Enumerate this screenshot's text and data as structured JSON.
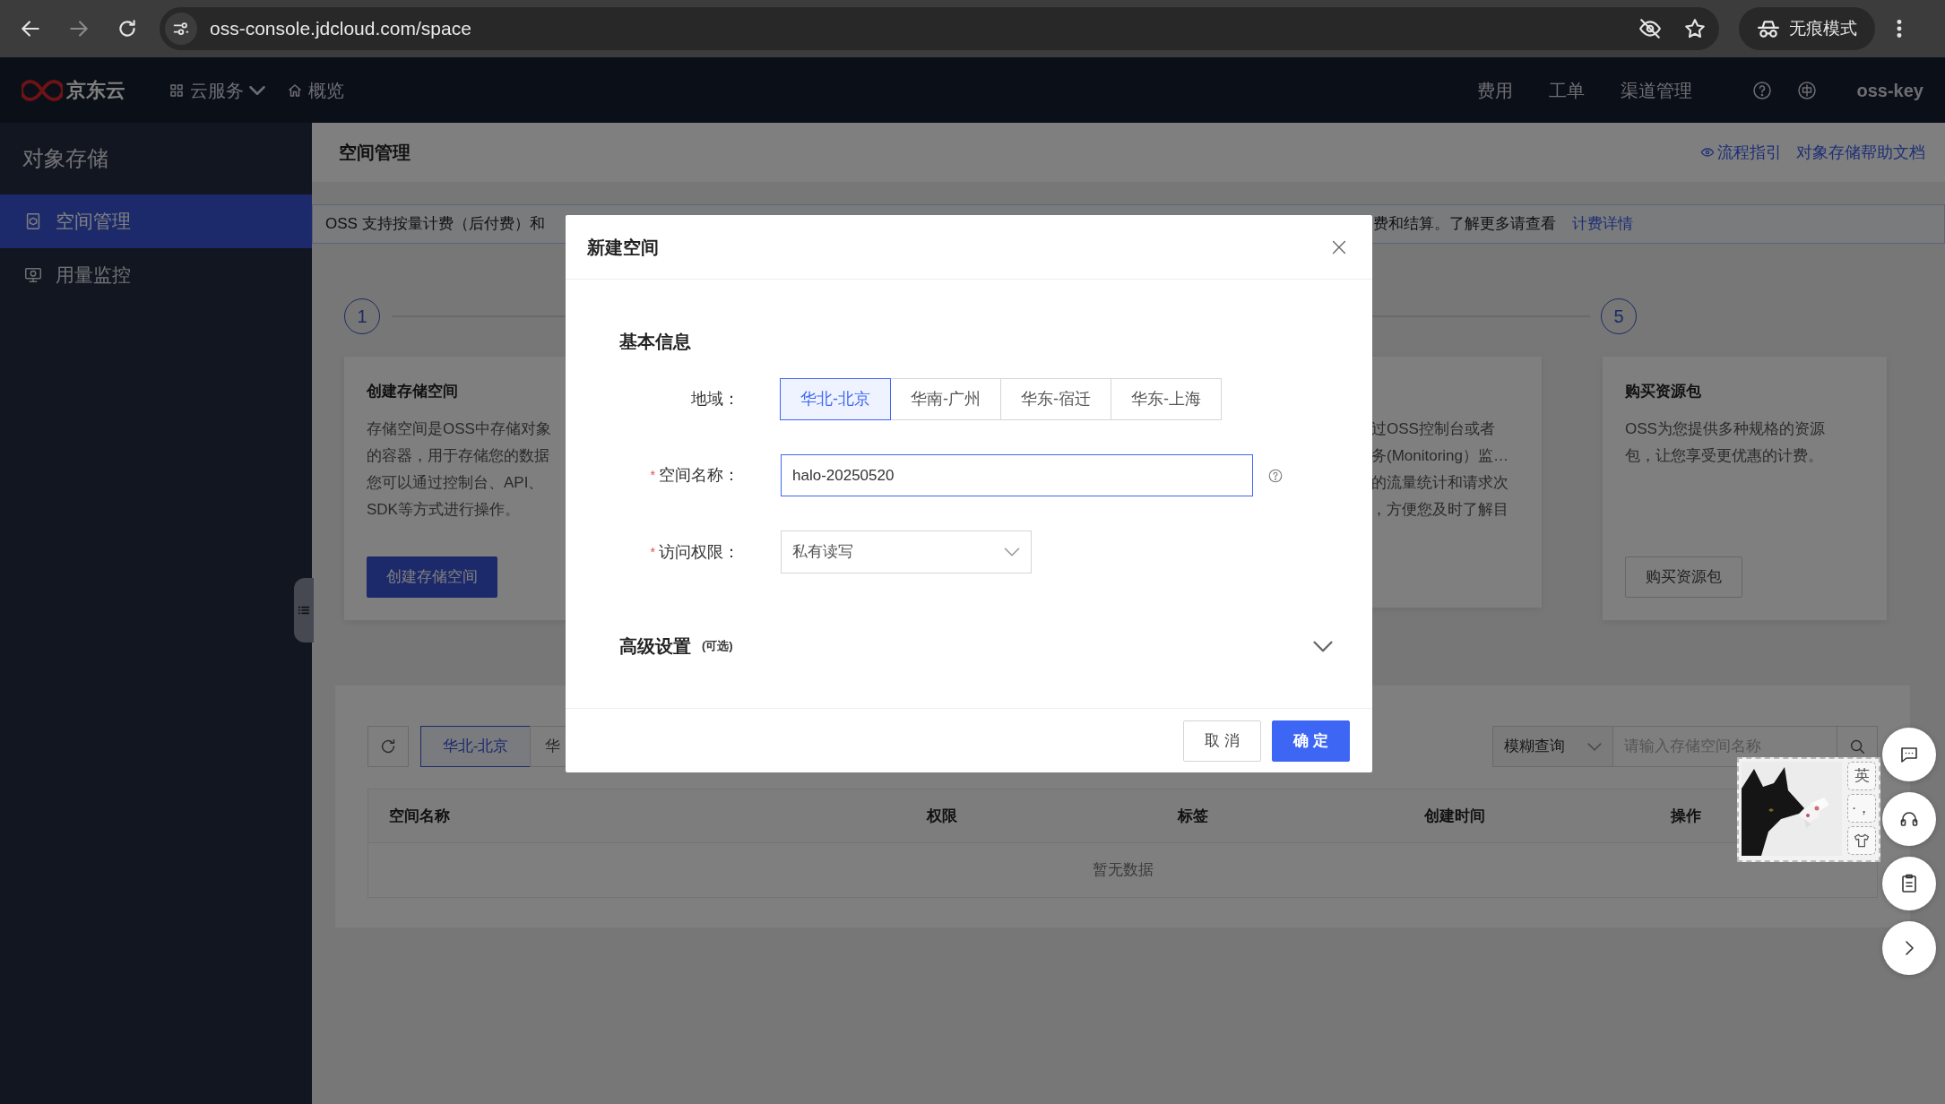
{
  "browser": {
    "url": "oss-console.jdcloud.com/space",
    "incognito_label": "无痕模式"
  },
  "topnav": {
    "logo_text": "京东云",
    "menu": [
      {
        "label": "云服务",
        "kind": "dropdown"
      },
      {
        "label": "概览",
        "kind": "home"
      }
    ],
    "right_links": [
      "费用",
      "工单",
      "渠道管理"
    ],
    "user": "oss-key"
  },
  "sidebar": {
    "title": "对象存储",
    "items": [
      {
        "label": "空间管理",
        "selected": true,
        "kind": "bucket"
      },
      {
        "label": "用量监控",
        "selected": false,
        "kind": "monitor"
      }
    ]
  },
  "header": {
    "title": "空间管理",
    "links": [
      {
        "label": "流程指引",
        "kind": "guide"
      },
      {
        "label": "对象存储帮助文档",
        "kind": "doc"
      }
    ]
  },
  "notice": {
    "left": "OSS 支持按量计费（后付费）和",
    "right": "费和结算。了解更多请查看",
    "link": "计费详情"
  },
  "steps": [
    "1",
    "5"
  ],
  "cards": [
    {
      "kind": "full",
      "title": "创建存储空间",
      "lines": [
        "存储空间是OSS中存储对象",
        "的容器，用于存储您的数据",
        "您可以通过控制台、API、",
        "SDK等方式进行操作。"
      ],
      "button": {
        "label": "创建存储空间",
        "kind": "primary"
      }
    },
    {
      "kind": "partial",
      "lines": [
        "过OSS控制台或者",
        "务(Monitoring）监…",
        "的流量统计和请求次",
        "，方便您及时了解目"
      ]
    },
    {
      "kind": "full",
      "title": "购买资源包",
      "lines": [
        "OSS为您提供多种规格的资源",
        "包，让您享受更优惠的计费。"
      ],
      "button": {
        "label": "购买资源包",
        "kind": "outline"
      }
    }
  ],
  "bucket_list": {
    "regions": [
      {
        "label": "华北-北京",
        "selected": true
      },
      {
        "label": "华",
        "selected": false
      }
    ],
    "search_mode": "模糊查询",
    "search_placeholder": "请输入存储空间名称",
    "columns": [
      "空间名称",
      "权限",
      "标签",
      "创建时间",
      "操作"
    ],
    "empty_text": "暂无数据"
  },
  "modal": {
    "title": "新建空间",
    "section": "基本信息",
    "fields": [
      {
        "kind": "segmented",
        "label": "地域：",
        "options": [
          {
            "label": "华北-北京",
            "selected": true
          },
          {
            "label": "华南-广州",
            "selected": false
          },
          {
            "label": "华东-宿迁",
            "selected": false
          },
          {
            "label": "华东-上海",
            "selected": false
          }
        ]
      },
      {
        "kind": "text",
        "label": "空间名称：",
        "required_mark": "*",
        "value": "halo-20250520",
        "focused": true,
        "help": true
      },
      {
        "kind": "select",
        "label": "访问权限：",
        "required_mark": "*",
        "value": "私有读写"
      }
    ],
    "advanced": {
      "title": "高级设置",
      "note": "(可选)",
      "expanded": false
    },
    "buttons": [
      {
        "label": "取 消",
        "kind": "secondary"
      },
      {
        "label": "确 定",
        "kind": "primary"
      }
    ]
  },
  "ime": {
    "keys": [
      {
        "kind": "text",
        "label": "英"
      },
      {
        "kind": "text",
        "label": "·，"
      },
      {
        "kind": "skin"
      }
    ]
  },
  "float_buttons": [
    {
      "kind": "chat"
    },
    {
      "kind": "support"
    },
    {
      "kind": "clipboard"
    },
    {
      "kind": "next"
    }
  ]
}
